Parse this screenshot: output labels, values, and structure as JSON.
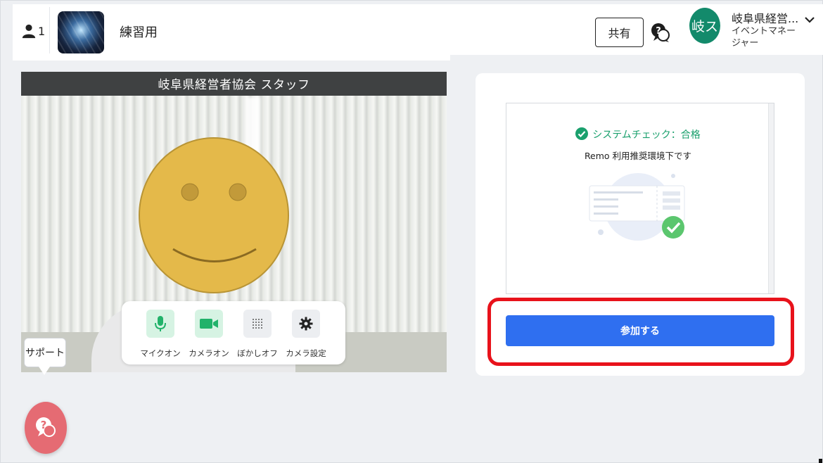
{
  "header": {
    "participant_count": "1",
    "room_name": "練習用",
    "share_label": "共有",
    "avatar_initials": "岐ス",
    "user_name": "岐阜県経営...",
    "user_role": "イベントマネージャー"
  },
  "video": {
    "name_label": "岐阜県経営者協会 スタッフ",
    "controls": [
      {
        "label": "マイクオン",
        "icon": "microphone-icon",
        "state": "on"
      },
      {
        "label": "カメラオン",
        "icon": "camera-icon",
        "state": "on"
      },
      {
        "label": "ぼかしオフ",
        "icon": "blur-icon",
        "state": "off"
      },
      {
        "label": "カメラ設定",
        "icon": "gear-icon",
        "state": "off"
      }
    ]
  },
  "support": {
    "label": "サポート"
  },
  "system_check": {
    "title": "システムチェック：合格",
    "subtitle": "Remo 利用推奨環境下です"
  },
  "join_button_label": "参加する",
  "colors": {
    "accent_blue": "#2f6ff0",
    "success_green": "#1aa06d",
    "avatar_green": "#138a6b",
    "highlight_red": "#e8121b",
    "help_pink": "#e56b73"
  }
}
